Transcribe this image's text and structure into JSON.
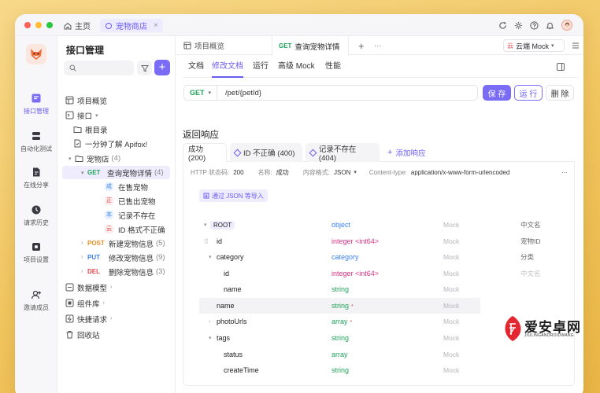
{
  "titlebar": {
    "home_label": "主页",
    "shop_tab_label": "宠物商店",
    "close_glyph": "×"
  },
  "rail": {
    "items": [
      {
        "label": "接口管理",
        "icon": "api-icon"
      },
      {
        "label": "自动化测试",
        "icon": "test-icon"
      },
      {
        "label": "在线分享",
        "icon": "share-icon"
      },
      {
        "label": "请求历史",
        "icon": "history-icon"
      },
      {
        "label": "项目设置",
        "icon": "settings-icon"
      },
      {
        "label": "邀请成员",
        "icon": "invite-icon"
      }
    ]
  },
  "tree": {
    "title": "接口管理",
    "add_glyph": "+",
    "nodes": {
      "overview": "项目概览",
      "api": "接口",
      "root_dir": "根目录",
      "intro": "一分钟了解 Apifox!",
      "petstore": "宠物店",
      "petstore_count": "(4)",
      "query_method": "GET",
      "query_label": "查询宠物详情",
      "query_count": "(4)",
      "case1_badge": "成",
      "case1": "在售宠物",
      "case2_badge": "正",
      "case2": "已售出宠物",
      "case3_badge": "本",
      "case3": "记录不存在",
      "case4_badge": "云",
      "case4": "ID 格式不正确",
      "post_method": "POST",
      "post_label": "新建宠物信息",
      "post_count": "(5)",
      "put_method": "PUT",
      "put_label": "修改宠物信息",
      "put_count": "(9)",
      "del_method": "DEL",
      "del_label": "删除宠物信息",
      "del_count": "(3)",
      "models": "数据模型",
      "components": "组件库",
      "quick": "快捷请求",
      "trash": "回收站"
    }
  },
  "doc_tabs": {
    "overview": "项目概览",
    "active_method": "GET",
    "active_label": "查询宠物详情",
    "add_glyph": "+",
    "more_glyph": "···",
    "env_prefix": "云",
    "env_label": "云端 Mock"
  },
  "sub_tabs": [
    "文档",
    "修改文档",
    "运行",
    "高级 Mock",
    "性能"
  ],
  "request": {
    "method": "GET",
    "path": "/pet/{petId}",
    "save": "保 存",
    "run": "运 行",
    "delete": "删 除"
  },
  "response": {
    "title": "返回响应",
    "tabs": [
      "成功 (200)",
      "ID 不正确 (400)",
      "记录不存在 (404)"
    ],
    "add_label": "添加响应",
    "meta": {
      "status_label": "HTTP 状态码:",
      "status_value": "200",
      "name_label": "名称:",
      "name_value": "成功",
      "format_label": "内容格式:",
      "format_value": "JSON",
      "ctype_label": "Content-type:",
      "ctype_value": "application/x-www-form-urlencoded",
      "more": "···"
    },
    "import_label": "通过 JSON 等导入",
    "schema": [
      {
        "name": "ROOT",
        "type": "object",
        "mock": "Mock",
        "cn": "中文名"
      },
      {
        "name": "id",
        "type": "integer <int64>",
        "mock": "Mock",
        "cn": "宠物ID"
      },
      {
        "name": "category",
        "type": "category",
        "mock": "Mock",
        "cn": "分类"
      },
      {
        "name": "id",
        "type": "integer <int64>",
        "mock": "Mock",
        "cn": "中文名"
      },
      {
        "name": "name",
        "type": "string",
        "mock": "Mock",
        "cn": ""
      },
      {
        "name": "name",
        "type": "string",
        "mock": "Mock",
        "cn": ""
      },
      {
        "name": "photoUrls",
        "type": "array",
        "mock": "Mock",
        "cn": ""
      },
      {
        "name": "tags",
        "type": "string",
        "mock": "Mock",
        "cn": ""
      },
      {
        "name": "status",
        "type": "array",
        "mock": "Mock",
        "cn": ""
      },
      {
        "name": "createTime",
        "type": "string",
        "mock": "Mock",
        "cn": ""
      }
    ],
    "required_glyph": "*"
  },
  "watermark": {
    "main": "爱安卓网",
    "sub": "JIULINGANDROIDWANG"
  },
  "colors": {
    "accent": "#7b6cf6",
    "get": "#20a35a",
    "post": "#e8902b",
    "put": "#3b82f6",
    "delete": "#e5484d",
    "background": "#f0c45d"
  }
}
